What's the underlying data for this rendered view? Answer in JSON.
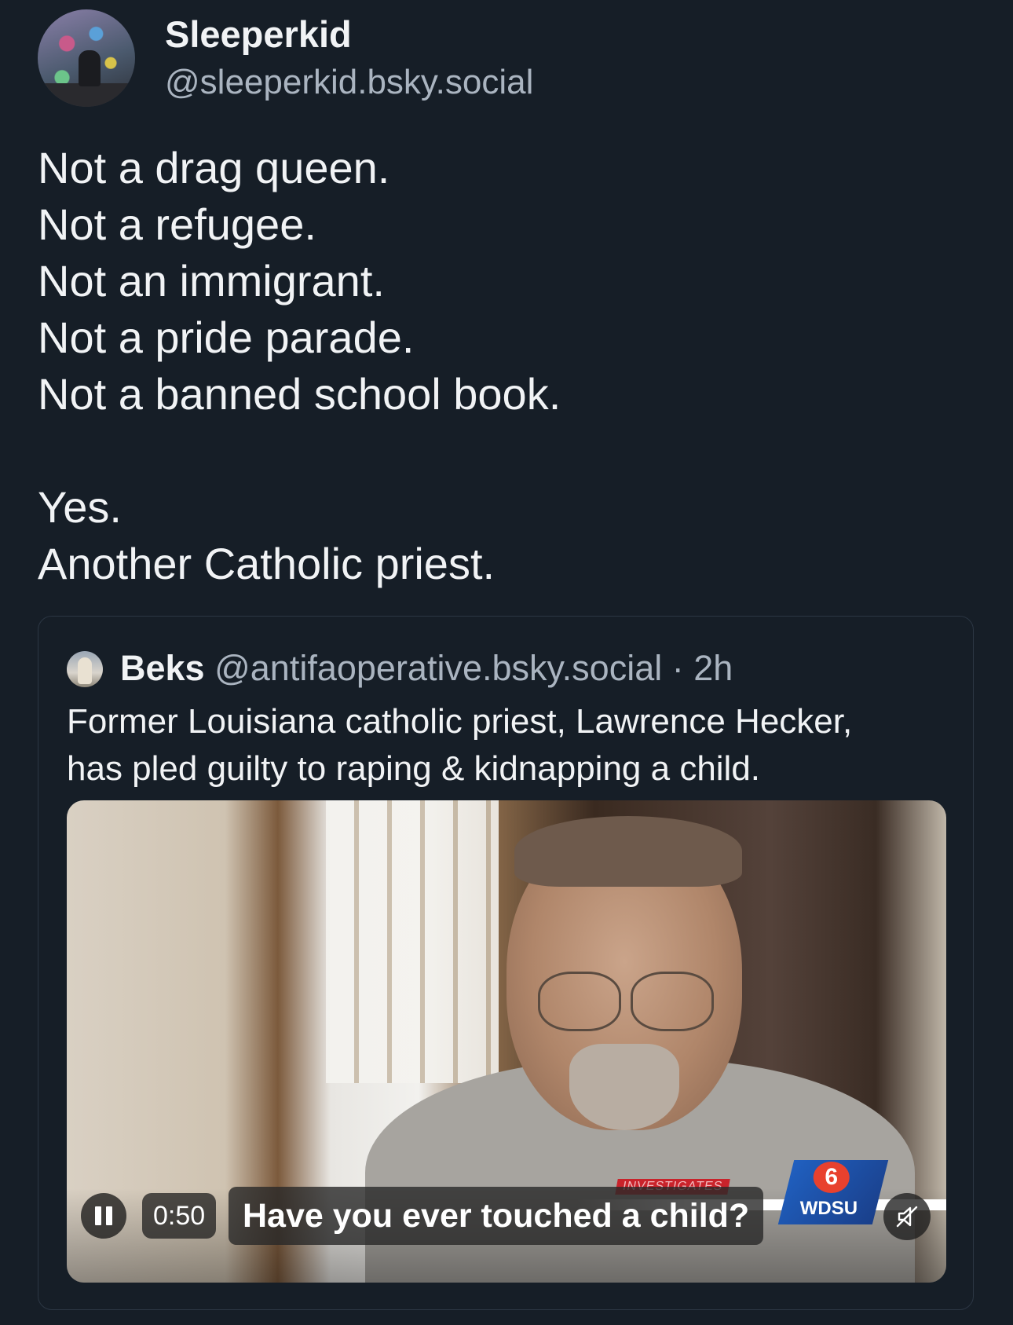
{
  "author": {
    "display_name": "Sleeperkid",
    "handle": "@sleeperkid.bsky.social"
  },
  "post": {
    "lines_block1": [
      "Not a drag queen.",
      "Not a refugee.",
      "Not an immigrant.",
      "Not a pride parade.",
      "Not a banned school book."
    ],
    "lines_block2": [
      "Yes.",
      "Another Catholic priest."
    ]
  },
  "quote": {
    "author_name": "Beks",
    "author_handle": "@antifaoperative.bsky.social",
    "separator": " · ",
    "time_ago": "2h",
    "text_lines": [
      "Former Louisiana catholic priest, Lawrence Hecker,",
      "has pled guilty to raping & kidnapping a child."
    ],
    "video": {
      "time": "0:50",
      "caption": "Have you ever touched a child?",
      "banner": "INVESTIGATES",
      "station_number": "6",
      "station_name": "WDSU",
      "pause_icon": "pause-icon",
      "mute_icon": "muted-speaker-icon"
    }
  }
}
